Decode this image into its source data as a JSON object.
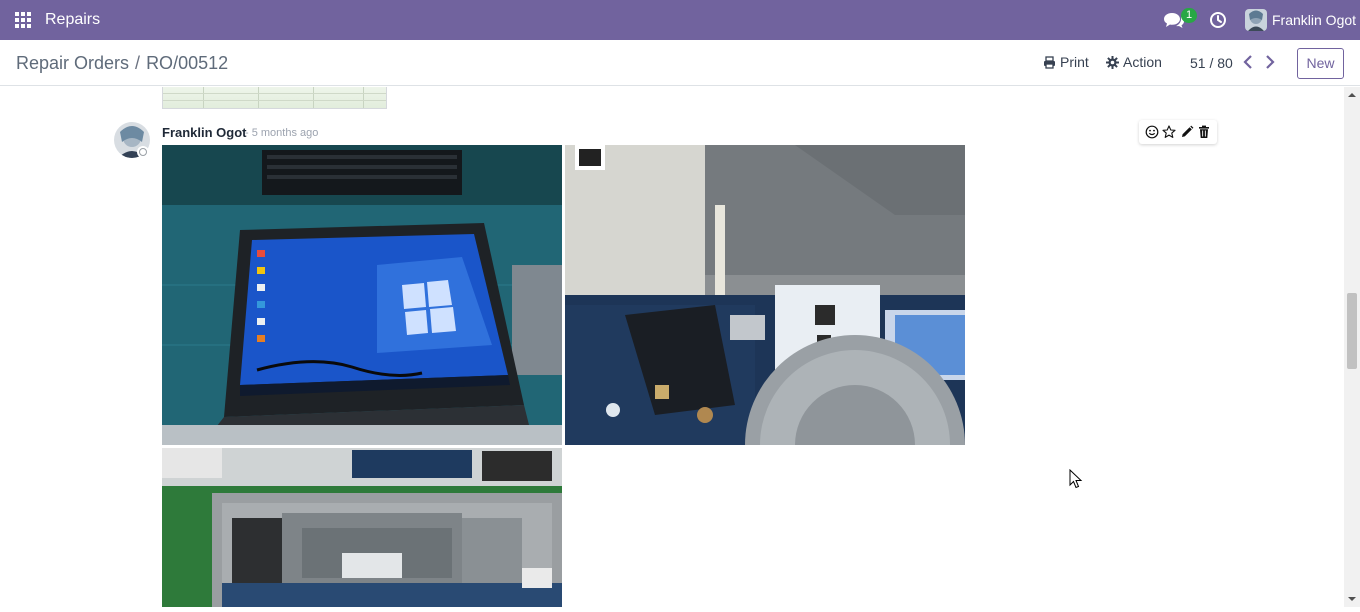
{
  "navbar": {
    "apps_icon": "grid-icon",
    "app_name": "Repairs",
    "messages_icon": "chat-bubbles-icon",
    "messages_count": "1",
    "activity_icon": "clock-icon",
    "user_name": "Franklin Ogot"
  },
  "control_panel": {
    "breadcrumb": {
      "parent": "Repair Orders",
      "separator": "/",
      "current": "RO/00512"
    },
    "print_label": "Print",
    "action_label": "Action",
    "pager": {
      "value": "51 / 80"
    },
    "new_label": "New"
  },
  "message": {
    "author": "Franklin Ogot",
    "date": "- 5 months ago",
    "actions": [
      "smiley-icon",
      "star-icon",
      "pencil-icon",
      "trash-icon"
    ],
    "attachments": [
      {
        "name": "laptop-windows-screen-image"
      },
      {
        "name": "motherboard-fan-closeup-image"
      },
      {
        "name": "laptop-bottom-case-image"
      }
    ]
  },
  "colors": {
    "brand": "#71639e",
    "badge": "#28a745",
    "text": "#374151"
  }
}
